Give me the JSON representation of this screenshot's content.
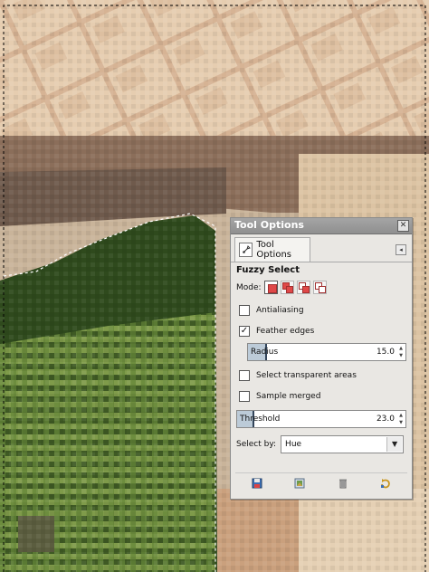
{
  "canvas": {
    "description_colors": {
      "pavement_light": "#e3c9a8",
      "pavement_mid": "#d2a987",
      "pavement_dark": "#8c6d58",
      "grass": "#5c7d34",
      "grass_dark": "#2f3c19",
      "selection_outline": "#ffffff"
    }
  },
  "dock": {
    "title": "Tool Options",
    "close_glyph": "✕",
    "tab_label": "Tool Options",
    "tab_icon": "tool-options-icon",
    "menu_glyph": "◂",
    "tool_name": "Fuzzy Select",
    "mode_label": "Mode:",
    "modes": [
      "replace",
      "add",
      "subtract",
      "intersect"
    ],
    "antialiasing": {
      "label": "Antialiasing",
      "checked": false
    },
    "feather_edges": {
      "label": "Feather edges",
      "checked": true
    },
    "radius": {
      "label": "Radius",
      "value": "15.0",
      "fill_fraction": 0.11
    },
    "select_transparent": {
      "label": "Select transparent areas",
      "checked": false
    },
    "sample_merged": {
      "label": "Sample merged",
      "checked": false
    },
    "threshold": {
      "label": "Threshold",
      "value": "23.0",
      "fill_fraction": 0.09
    },
    "select_by": {
      "label": "Select by:",
      "value": "Hue"
    },
    "bottom_buttons": [
      "save-preset-icon",
      "restore-preset-icon",
      "delete-preset-icon",
      "reset-icon"
    ]
  }
}
